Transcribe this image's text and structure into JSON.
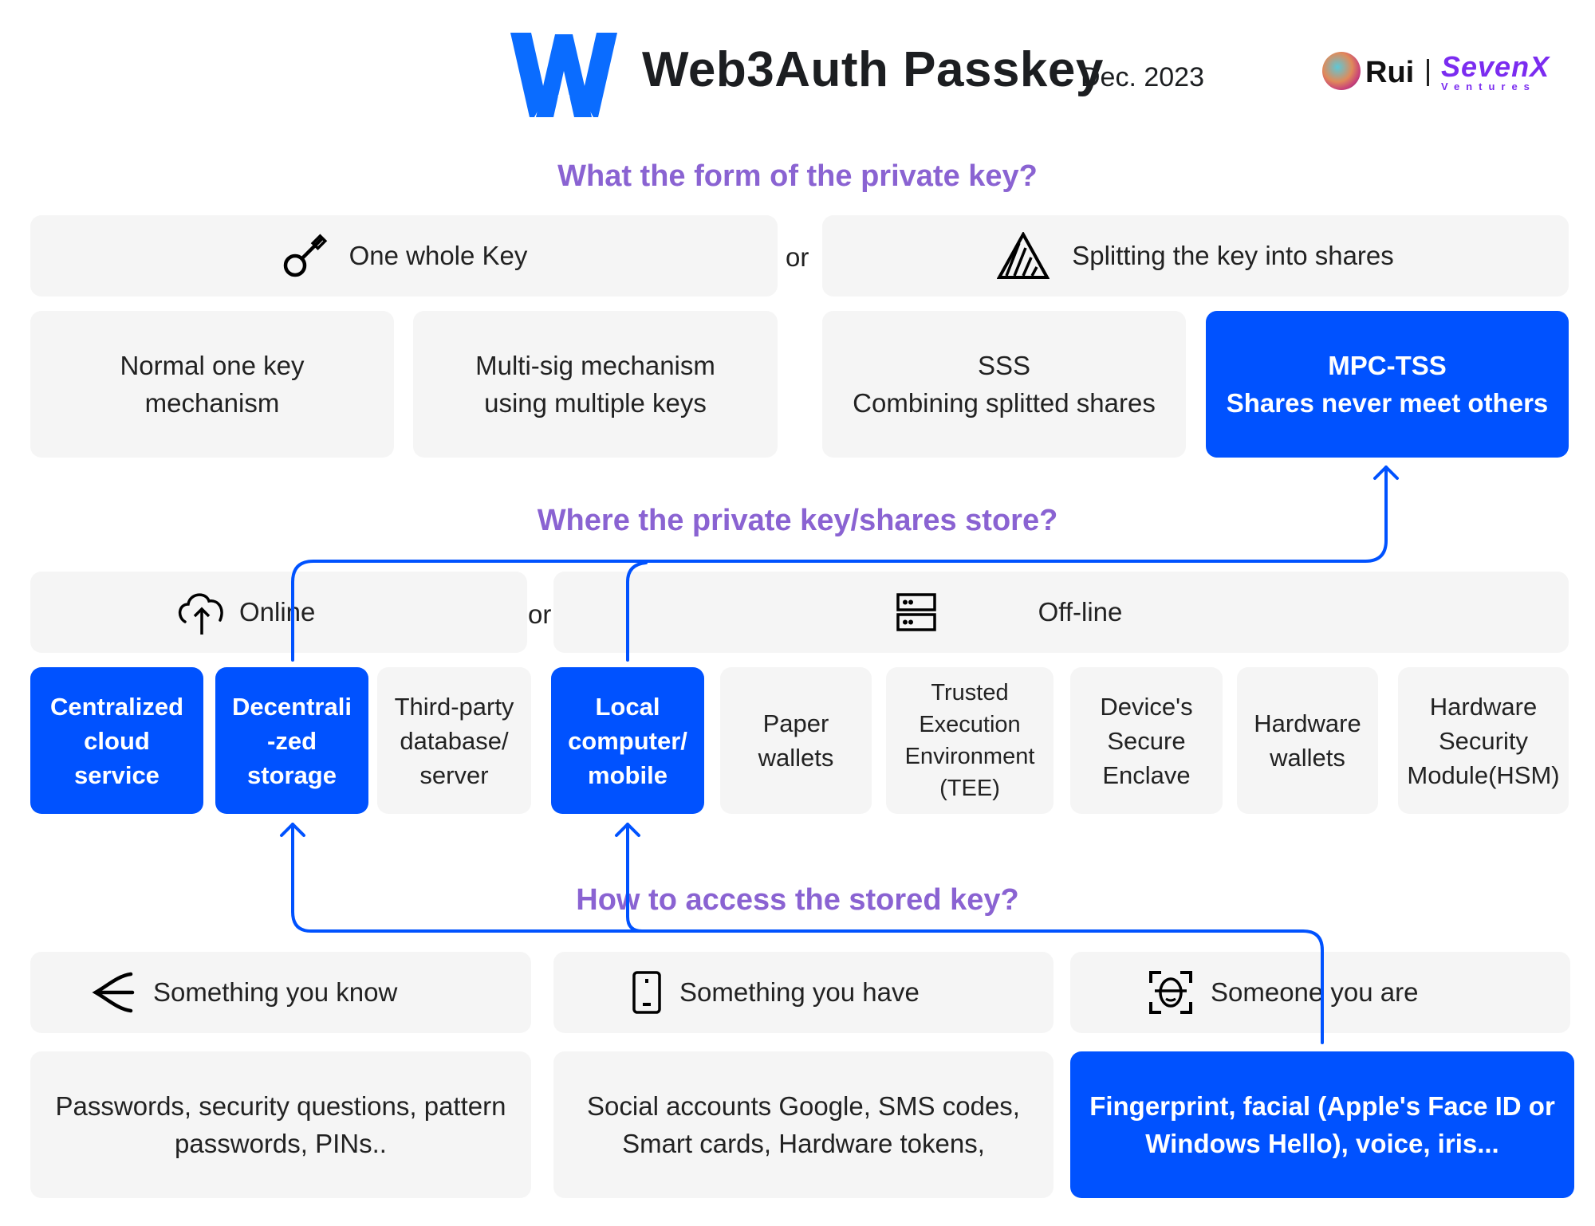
{
  "header": {
    "logo": "web3auth-logo-icon",
    "title": "Web3Auth Passkey",
    "date": "Dec. 2023",
    "author": "Rui",
    "brand_top": "SevenX",
    "brand_bottom": "Ventures"
  },
  "colors": {
    "accent_blue": "#0052ff",
    "heading_purple": "#8a63d2",
    "box_gray": "#f5f5f5",
    "brand_purple": "#7b2cf0"
  },
  "section1": {
    "question": "What the form of the private key?",
    "left_header": {
      "icon": "key-icon",
      "label": "One whole Key"
    },
    "or_label": "or",
    "right_header": {
      "icon": "striped-triangle-icon",
      "label": "Splitting the key into shares"
    },
    "options": [
      {
        "lines": [
          "Normal one key",
          "mechanism"
        ],
        "highlighted": false
      },
      {
        "lines": [
          "Multi-sig mechanism",
          "using multiple keys"
        ],
        "highlighted": false
      },
      {
        "lines": [
          "SSS",
          "Combining splitted shares"
        ],
        "highlighted": false
      },
      {
        "lines": [
          "MPC-TSS",
          "Shares never meet others"
        ],
        "highlighted": true
      }
    ]
  },
  "section2": {
    "question": "Where the private key/shares store?",
    "left_header": {
      "icon": "cloud-upload-icon",
      "label": "Online"
    },
    "or_label": "or",
    "right_header": {
      "icon": "server-icon",
      "label": "Off-line"
    },
    "options": [
      {
        "lines": [
          "Centralized",
          "cloud",
          "service"
        ],
        "highlighted": true
      },
      {
        "lines": [
          "Decentrali",
          "-zed",
          "storage"
        ],
        "highlighted": true
      },
      {
        "lines": [
          "Third-party",
          "database/",
          "server"
        ],
        "highlighted": false
      },
      {
        "lines": [
          "Local",
          "computer/",
          "mobile"
        ],
        "highlighted": true
      },
      {
        "lines": [
          "Paper",
          "wallets"
        ],
        "highlighted": false
      },
      {
        "lines": [
          "Trusted",
          "Execution",
          "Environment",
          "(TEE)"
        ],
        "highlighted": false
      },
      {
        "lines": [
          "Device's",
          "Secure",
          "Enclave"
        ],
        "highlighted": false
      },
      {
        "lines": [
          "Hardware",
          "wallets"
        ],
        "highlighted": false
      },
      {
        "lines": [
          "Hardware",
          "Security",
          "Module(HSM)"
        ],
        "highlighted": false
      }
    ]
  },
  "section3": {
    "question": "How to access the stored key?",
    "headers": [
      {
        "icon": "less-than-branch-icon",
        "label": "Something you know"
      },
      {
        "icon": "phone-icon",
        "label": "Something you have"
      },
      {
        "icon": "face-scan-icon",
        "label": "Someone you are"
      }
    ],
    "options": [
      {
        "lines": [
          "Passwords, security questions, pattern",
          "passwords, PINs.."
        ],
        "highlighted": false
      },
      {
        "lines": [
          "Social accounts Google, SMS codes,",
          "Smart cards, Hardware tokens,"
        ],
        "highlighted": false
      },
      {
        "lines": [
          "Fingerprint, facial (Apple's Face ID or",
          "Windows Hello), voice, iris..."
        ],
        "highlighted": true
      }
    ]
  },
  "connectors": [
    {
      "from": "Decentralized storage",
      "to": "MPC-TSS"
    },
    {
      "from": "Local computer/mobile",
      "to": "MPC-TSS"
    },
    {
      "from": "Someone you are",
      "to": "Decentralized storage"
    },
    {
      "from": "Someone you are",
      "to": "Local computer/mobile"
    }
  ]
}
